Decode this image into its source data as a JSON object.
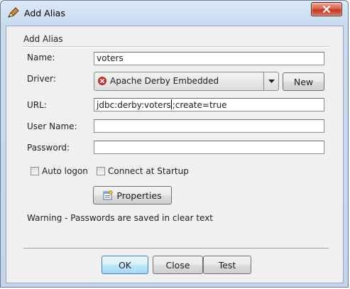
{
  "window": {
    "title": "Add Alias"
  },
  "group": {
    "title": "Add Alias"
  },
  "fields": {
    "name_label": "Name:",
    "name_value": "voters",
    "driver_label": "Driver:",
    "driver_value": "Apache Derby Embedded",
    "url_label": "URL:",
    "url_value_before_caret": "jdbc:derby:voters",
    "url_value_after_caret": ";create=true",
    "username_label": "User Name:",
    "username_value": "",
    "password_label": "Password:",
    "password_value": ""
  },
  "buttons": {
    "new": "New",
    "properties": "Properties",
    "ok": "OK",
    "close": "Close",
    "test": "Test"
  },
  "checkboxes": {
    "auto_logon": {
      "label": "Auto logon",
      "checked": false
    },
    "connect_at_startup": {
      "label": "Connect at Startup",
      "checked": false
    }
  },
  "warning": "Warning - Passwords are saved in clear text",
  "icons": {
    "app": "pencil-icon",
    "driver_status": "error-circle-icon",
    "dropdown": "chevron-down-icon",
    "properties": "properties-icon",
    "close": "close-icon"
  },
  "colors": {
    "window_frame": "#c3d6ec",
    "close_button": "#c23a22",
    "error_icon": "#d0362a",
    "focus_button_border": "#3c7fb1"
  }
}
